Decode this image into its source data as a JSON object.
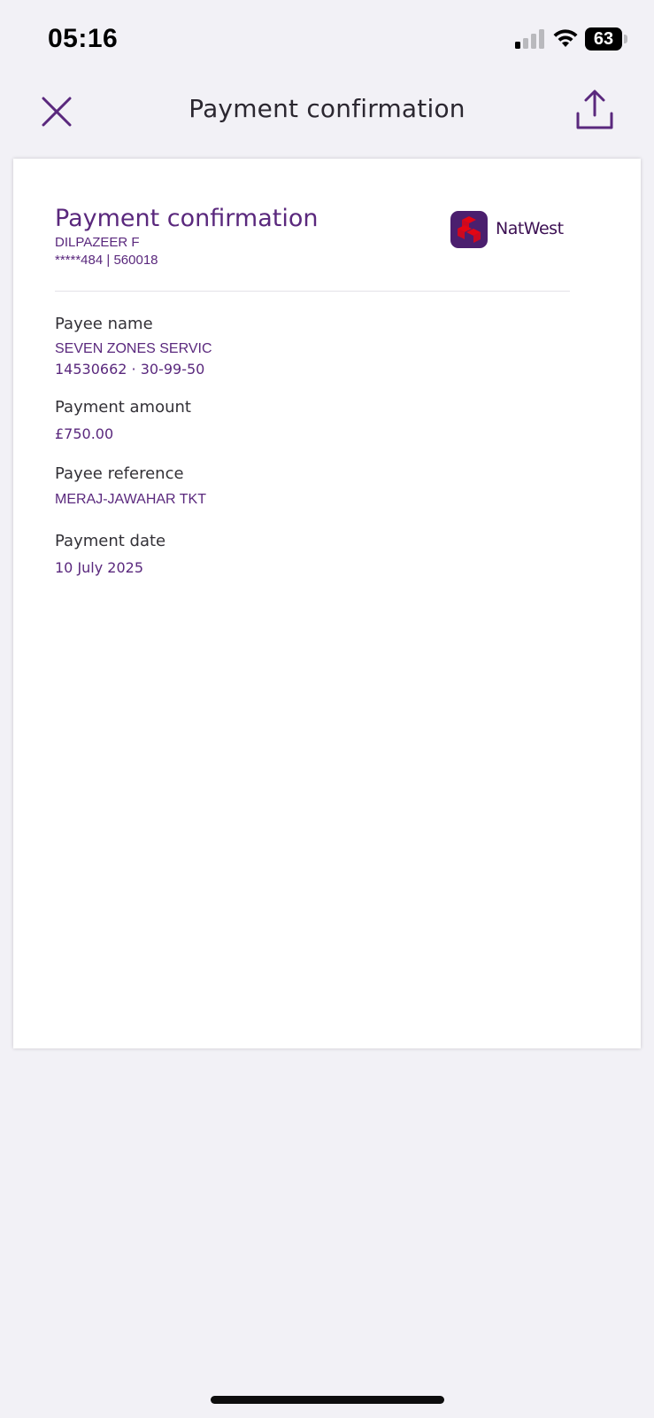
{
  "status_bar": {
    "time": "05:16",
    "battery_level": "63",
    "signal_bars_active": 1,
    "signal_bars_total": 4
  },
  "header": {
    "title": "Payment confirmation",
    "close_icon": "close-icon",
    "share_icon": "share-icon"
  },
  "document": {
    "title": "Payment confirmation",
    "account_name": "DILPAZEER F",
    "account_number": "*****484  |  560018",
    "brand": {
      "name": "NatWest",
      "logo_color": "#4b1f6e",
      "mark_color": "#e30613"
    },
    "fields": [
      {
        "label": "Payee name",
        "lines": [
          "SEVEN ZONES SERVIC",
          "14530662 · 30-99-50"
        ]
      },
      {
        "label": "Payment amount",
        "lines": [
          "£750.00"
        ]
      },
      {
        "label": "Payee reference",
        "lines": [
          "MERAJ-JAWAHAR TKT"
        ]
      },
      {
        "label": "Payment date",
        "lines": [
          "10 July 2025"
        ]
      }
    ]
  },
  "colors": {
    "accent": "#5a287d",
    "background": "#f2f1f6",
    "card": "#ffffff"
  }
}
